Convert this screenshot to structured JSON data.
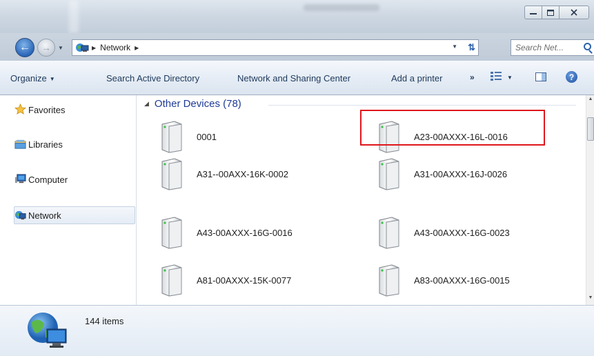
{
  "window": {
    "minimize_glyph": "—",
    "maximize_glyph": "□",
    "close_glyph": "✕"
  },
  "address": {
    "crumbs": [
      "Network"
    ],
    "search_placeholder": "Search Net..."
  },
  "toolbar": {
    "organize": "Organize",
    "search_ad": "Search Active Directory",
    "network_sharing": "Network and Sharing Center",
    "add_printer": "Add a printer",
    "more": "»"
  },
  "sidebar": {
    "items": [
      {
        "label": "Favorites",
        "icon": "star-icon"
      },
      {
        "label": "Libraries",
        "icon": "libraries-icon"
      },
      {
        "label": "Computer",
        "icon": "computer-icon"
      },
      {
        "label": "Network",
        "icon": "network-icon"
      }
    ]
  },
  "main": {
    "group_title": "Other Devices (78)",
    "devices": [
      "0001",
      "A23-00AXXX-16L-0016",
      "A31--00AXX-16K-0002",
      "A31-00AXXX-16J-0026",
      "A43-00AXXX-16G-0016",
      "A43-00AXXX-16G-0023",
      "A81-00AXXX-15K-0077",
      "A83-00AXXX-16G-0015"
    ]
  },
  "status": {
    "item_count": "144 items"
  },
  "colors": {
    "group_title": "#1e3a96",
    "highlight_border": "#e0161c"
  }
}
